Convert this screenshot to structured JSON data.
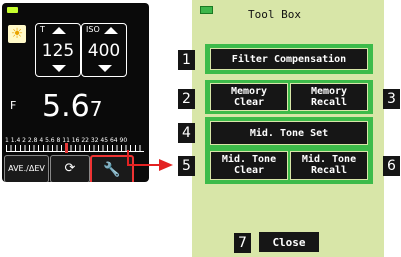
{
  "meter": {
    "battery_icon": "battery-icon",
    "mode_icon": "sun-icon",
    "t_label": "T",
    "t_value": "125",
    "iso_label": "ISO",
    "iso_value": "400",
    "f_label": "F",
    "f_main": "5.6",
    "f_sub": "7",
    "scale_numbers": "1 1.4 2 2.8 4 5.6 8 11 16 22 32 45 64 90",
    "ave_button": "AVE./ΔEV",
    "center_icon": "meter-mode-icon",
    "tool_icon": "wrench-icon"
  },
  "toolbox": {
    "title": "Tool Box",
    "filter": "Filter Compensation",
    "memory_clear_1": "Memory",
    "memory_clear_2": "Clear",
    "memory_recall_1": "Memory",
    "memory_recall_2": "Recall",
    "midtone_set": "Mid. Tone Set",
    "midtone_clear_1": "Mid. Tone",
    "midtone_clear_2": "Clear",
    "midtone_recall_1": "Mid. Tone",
    "midtone_recall_2": "Recall",
    "close": "Close"
  },
  "callouts": [
    "1",
    "2",
    "3",
    "4",
    "5",
    "6",
    "7"
  ],
  "colors": {
    "panel_bg": "#d8e6a8",
    "group_green": "#3dbb4a",
    "arrow_red": "#e32222"
  }
}
